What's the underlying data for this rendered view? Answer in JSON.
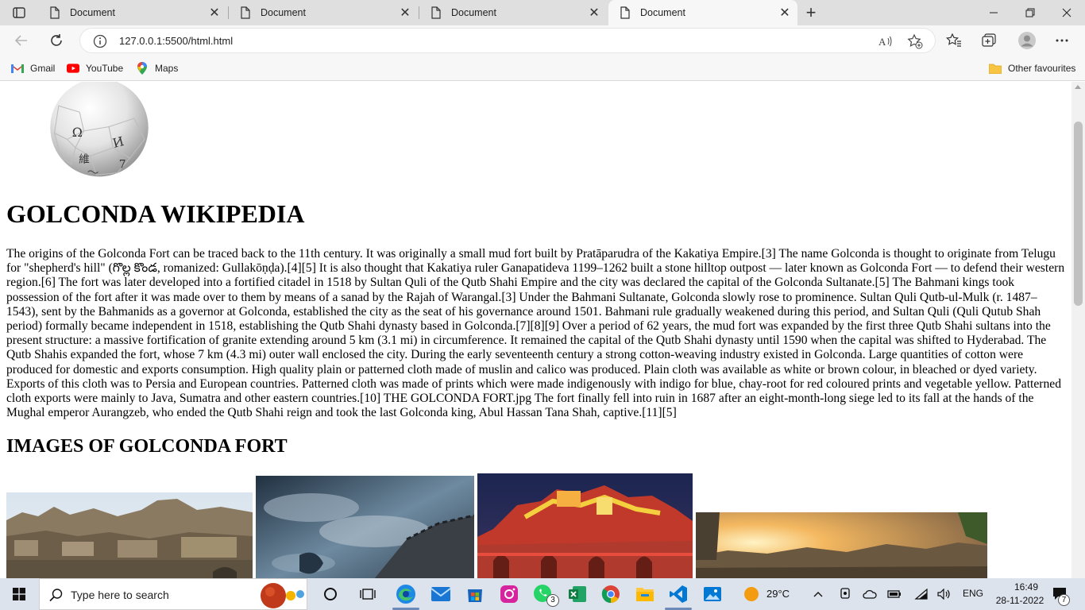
{
  "browser": {
    "tabs": [
      {
        "title": "Document",
        "icon": "page-icon"
      },
      {
        "title": "Document",
        "icon": "page-icon"
      },
      {
        "title": "Document",
        "icon": "page-icon"
      },
      {
        "title": "Document",
        "icon": "page-icon"
      }
    ],
    "active_tab": 3,
    "url": "127.0.0.1:5500/html.html",
    "favourites": [
      {
        "label": "Gmail",
        "icon": "gmail-icon"
      },
      {
        "label": "YouTube",
        "icon": "youtube-icon"
      },
      {
        "label": "Maps",
        "icon": "maps-icon"
      }
    ],
    "other_favourites": "Other favourites"
  },
  "page": {
    "heading": "GOLCONDA WIKIPEDIA",
    "body": "The origins of the Golconda Fort can be traced back to the 11th century. It was originally a small mud fort built by Pratāparudra of the Kakatiya Empire.[3] The name Golconda is thought to originate from Telugu for \"shepherd's hill\" (గొల్ల కొండ, romanized: Gullakōṇḍa).[4][5] It is also thought that Kakatiya ruler Ganapatideva 1199–1262 built a stone hilltop outpost — later known as Golconda Fort — to defend their western region.[6] The fort was later developed into a fortified citadel in 1518 by Sultan Quli of the Qutb Shahi Empire and the city was declared the capital of the Golconda Sultanate.[5] The Bahmani kings took possession of the fort after it was made over to them by means of a sanad by the Rajah of Warangal.[3] Under the Bahmani Sultanate, Golconda slowly rose to prominence. Sultan Quli Qutb-ul-Mulk (r. 1487–1543), sent by the Bahmanids as a governor at Golconda, established the city as the seat of his governance around 1501. Bahmani rule gradually weakened during this period, and Sultan Quli (Quli Qutub Shah period) formally became independent in 1518, establishing the Qutb Shahi dynasty based in Golconda.[7][8][9] Over a period of 62 years, the mud fort was expanded by the first three Qutb Shahi sultans into the present structure: a massive fortification of granite extending around 5 km (3.1 mi) in circumference. It remained the capital of the Qutb Shahi dynasty until 1590 when the capital was shifted to Hyderabad. The Qutb Shahis expanded the fort, whose 7 km (4.3 mi) outer wall enclosed the city. During the early seventeenth century a strong cotton-weaving industry existed in Golconda. Large quantities of cotton were produced for domestic and exports consumption. High quality plain or patterned cloth made of muslin and calico was produced. Plain cloth was available as white or brown colour, in bleached or dyed variety. Exports of this cloth was to Persia and European countries. Patterned cloth was made of prints which were made indigenously with indigo for blue, chay-root for red coloured prints and vegetable yellow. Patterned cloth exports were mainly to Java, Sumatra and other eastern countries.[10] THE GOLCONDA FORT.jpg The fort finally fell into ruin in 1687 after an eight-month-long siege led to its fall at the hands of the Mughal emperor Aurangzeb, who ended the Qutb Shahi reign and took the last Golconda king, Abul Hassan Tana Shah, captive.[11][5]",
    "subheading": "IMAGES OF GOLCONDA FORT",
    "globe_glyphs": [
      "Ω",
      "И",
      "維",
      "7"
    ]
  },
  "taskbar": {
    "search_placeholder": "Type here to search",
    "weather": "29°C",
    "language": "ENG",
    "time": "16:49",
    "date": "28-11-2022",
    "whatsapp_badge": "3",
    "notification_badge": "7"
  },
  "colors": {
    "accent": "#0078d4",
    "tabstrip": "#dfdfdf",
    "toolbar": "#f7f7f7",
    "taskbar": "#dde3ec"
  }
}
